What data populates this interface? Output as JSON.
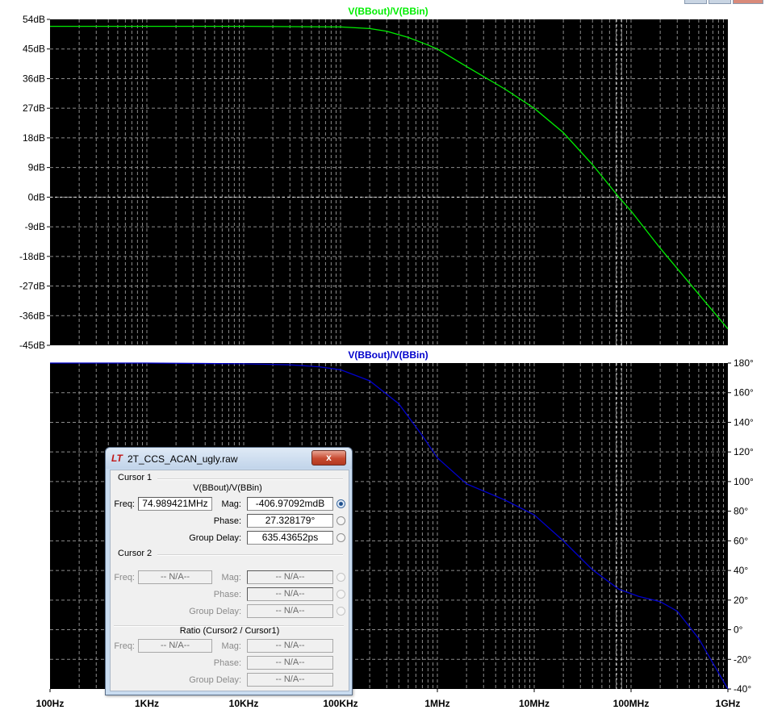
{
  "chart_data": [
    {
      "type": "line",
      "title": "V(BBout)/V(BBin)",
      "measure": "magnitude",
      "x_scale": "log",
      "xlim": [
        100,
        1000000000
      ],
      "x_ticks": [
        "100Hz",
        "1KHz",
        "10KHz",
        "100KHz",
        "1MHz",
        "10MHz",
        "100MHz",
        "1GHz"
      ],
      "ylim": [
        -45,
        54
      ],
      "y_ticks": [
        "54dB",
        "45dB",
        "36dB",
        "27dB",
        "18dB",
        "9dB",
        "0dB",
        "-9dB",
        "-18dB",
        "-27dB",
        "-36dB",
        "-45dB"
      ],
      "y_tick_values": [
        54,
        45,
        36,
        27,
        18,
        9,
        0,
        -9,
        -18,
        -27,
        -36,
        -45
      ],
      "grid": true,
      "series": [
        {
          "color": "#00ee00",
          "x": [
            100,
            1000,
            10000,
            100000,
            200000,
            300000,
            500000,
            800000,
            1000000,
            2000000,
            5000000,
            10000000,
            20000000,
            40000000,
            74989421,
            100000000,
            200000000,
            500000000,
            1000000000
          ],
          "y": [
            51.9,
            51.9,
            51.9,
            51.7,
            51.2,
            50.4,
            48.5,
            46.2,
            45.0,
            39.7,
            32.8,
            27.0,
            19.6,
            9.9,
            0.0,
            -4.2,
            -15.5,
            -29.5,
            -40.0
          ]
        }
      ]
    },
    {
      "type": "line",
      "title": "V(BBout)/V(BBin)",
      "measure": "phase",
      "x_scale": "log",
      "xlim": [
        100,
        1000000000
      ],
      "x_ticks": [
        "100Hz",
        "1KHz",
        "10KHz",
        "100KHz",
        "1MHz",
        "10MHz",
        "100MHz",
        "1GHz"
      ],
      "ylim": [
        -40,
        180
      ],
      "y_ticks": [
        "180°",
        "160°",
        "140°",
        "120°",
        "100°",
        "80°",
        "60°",
        "40°",
        "20°",
        "0°",
        "-20°",
        "-40°"
      ],
      "y_tick_values": [
        180,
        160,
        140,
        120,
        100,
        80,
        60,
        40,
        20,
        0,
        -20,
        -40
      ],
      "grid": true,
      "series": [
        {
          "color": "#0000cc",
          "x": [
            100,
            1000,
            10000,
            30000,
            60000,
            100000,
            200000,
            400000,
            700000,
            1000000,
            2000000,
            5000000,
            10000000,
            20000000,
            40000000,
            74989421,
            120000000,
            200000000,
            300000000,
            500000000,
            1000000000
          ],
          "y": [
            180,
            180,
            179.5,
            178.8,
            177.5,
            175.5,
            168.0,
            152.5,
            131.0,
            116.0,
            98.5,
            87.5,
            77.5,
            60.0,
            40.5,
            27.3,
            22.5,
            19.0,
            12.5,
            -6.0,
            -40.0
          ]
        }
      ]
    }
  ],
  "cursor": {
    "freq": 74989421
  },
  "dialog": {
    "logo": "LT",
    "title": "2T_CCS_ACAN_ugly.raw",
    "close_glyph": "x",
    "cursor1": {
      "group": "Cursor 1",
      "trace": "V(BBout)/V(BBin)",
      "freq_label": "Freq:",
      "freq_value": "74.989421MHz",
      "mag_label": "Mag:",
      "mag_value": "-406.97092mdB",
      "phase_label": "Phase:",
      "phase_value": "27.328179°",
      "gd_label": "Group Delay:",
      "gd_value": "635.43652ps"
    },
    "cursor2": {
      "group": "Cursor 2",
      "freq_label": "Freq:",
      "freq_value": "-- N/A--",
      "mag_label": "Mag:",
      "mag_value": "-- N/A--",
      "phase_label": "Phase:",
      "phase_value": "-- N/A--",
      "gd_label": "Group Delay:",
      "gd_value": "-- N/A--"
    },
    "ratio": {
      "group": "Ratio (Cursor2 / Cursor1)",
      "freq_label": "Freq:",
      "freq_value": "-- N/A--",
      "mag_label": "Mag:",
      "mag_value": "-- N/A--",
      "phase_label": "Phase:",
      "phase_value": "-- N/A--",
      "gd_label": "Group Delay:",
      "gd_value": "-- N/A--"
    }
  }
}
